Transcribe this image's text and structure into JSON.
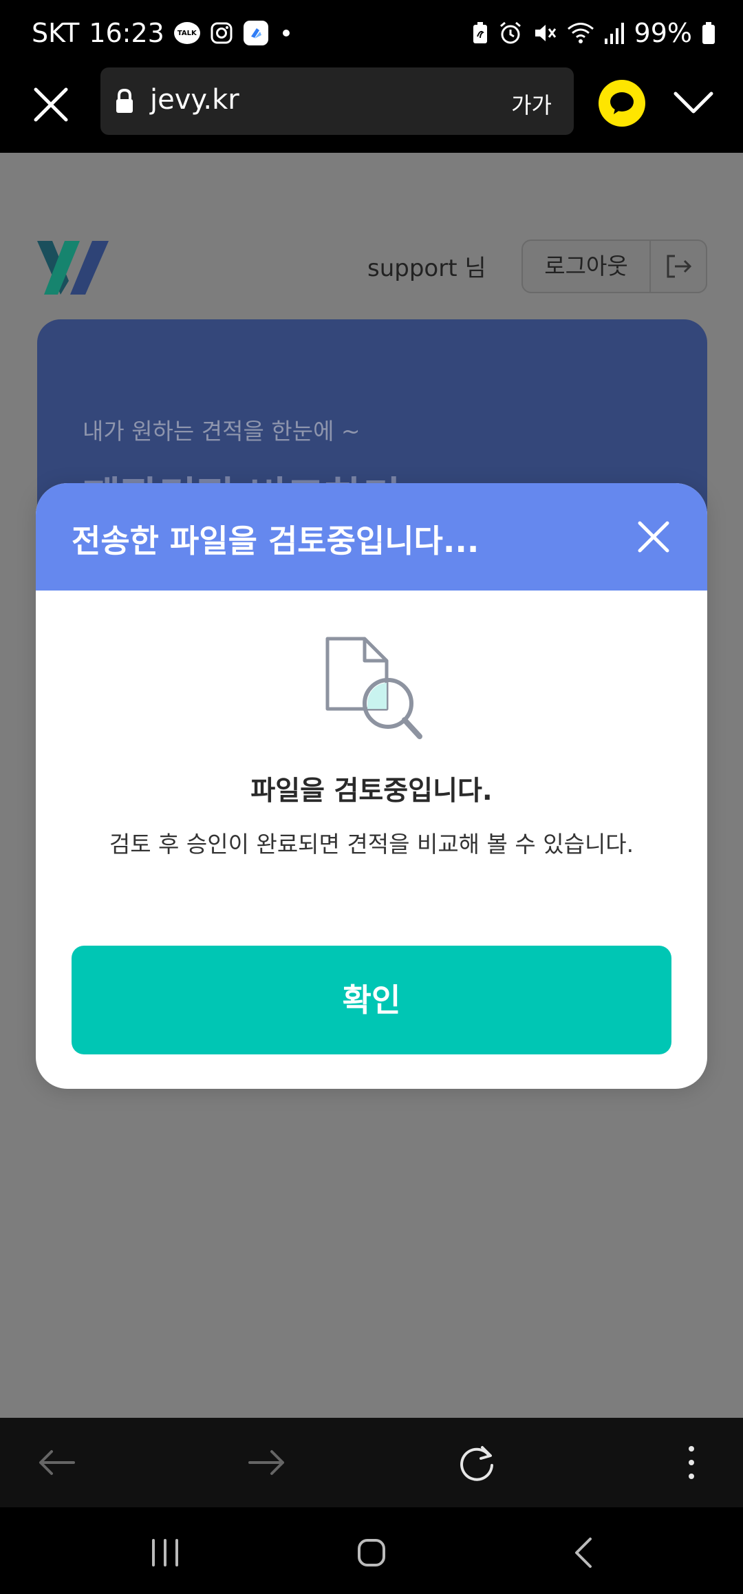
{
  "status_bar": {
    "carrier": "SKT",
    "time": "16:23",
    "talk_badge": "TALK",
    "battery": "99%"
  },
  "browser": {
    "url": "jevy.kr",
    "text_size": "가가"
  },
  "page": {
    "user_label": "support 님",
    "logout_label": "로그아웃",
    "hero_subtitle": "내가 원하는 견적을 한눈에 ~",
    "hero_title": "제작견적 비교하기"
  },
  "modal": {
    "title": "전송한 파일을 검토중입니다...",
    "heading": "파일을 검토중입니다.",
    "description": "검토 후 승인이 완료되면 견적을 비교해 볼 수 있습니다.",
    "confirm_label": "확인"
  },
  "colors": {
    "modal_header": "#6588ee",
    "confirm_button": "#00c6b4",
    "hero": "#34477a",
    "kakao": "#fee500"
  },
  "icons": [
    "close-icon",
    "lock-icon",
    "kakao-icon",
    "chevron-down-icon",
    "logout-icon",
    "file-search-icon",
    "back-arrow-icon",
    "forward-arrow-icon",
    "refresh-icon",
    "more-icon"
  ]
}
